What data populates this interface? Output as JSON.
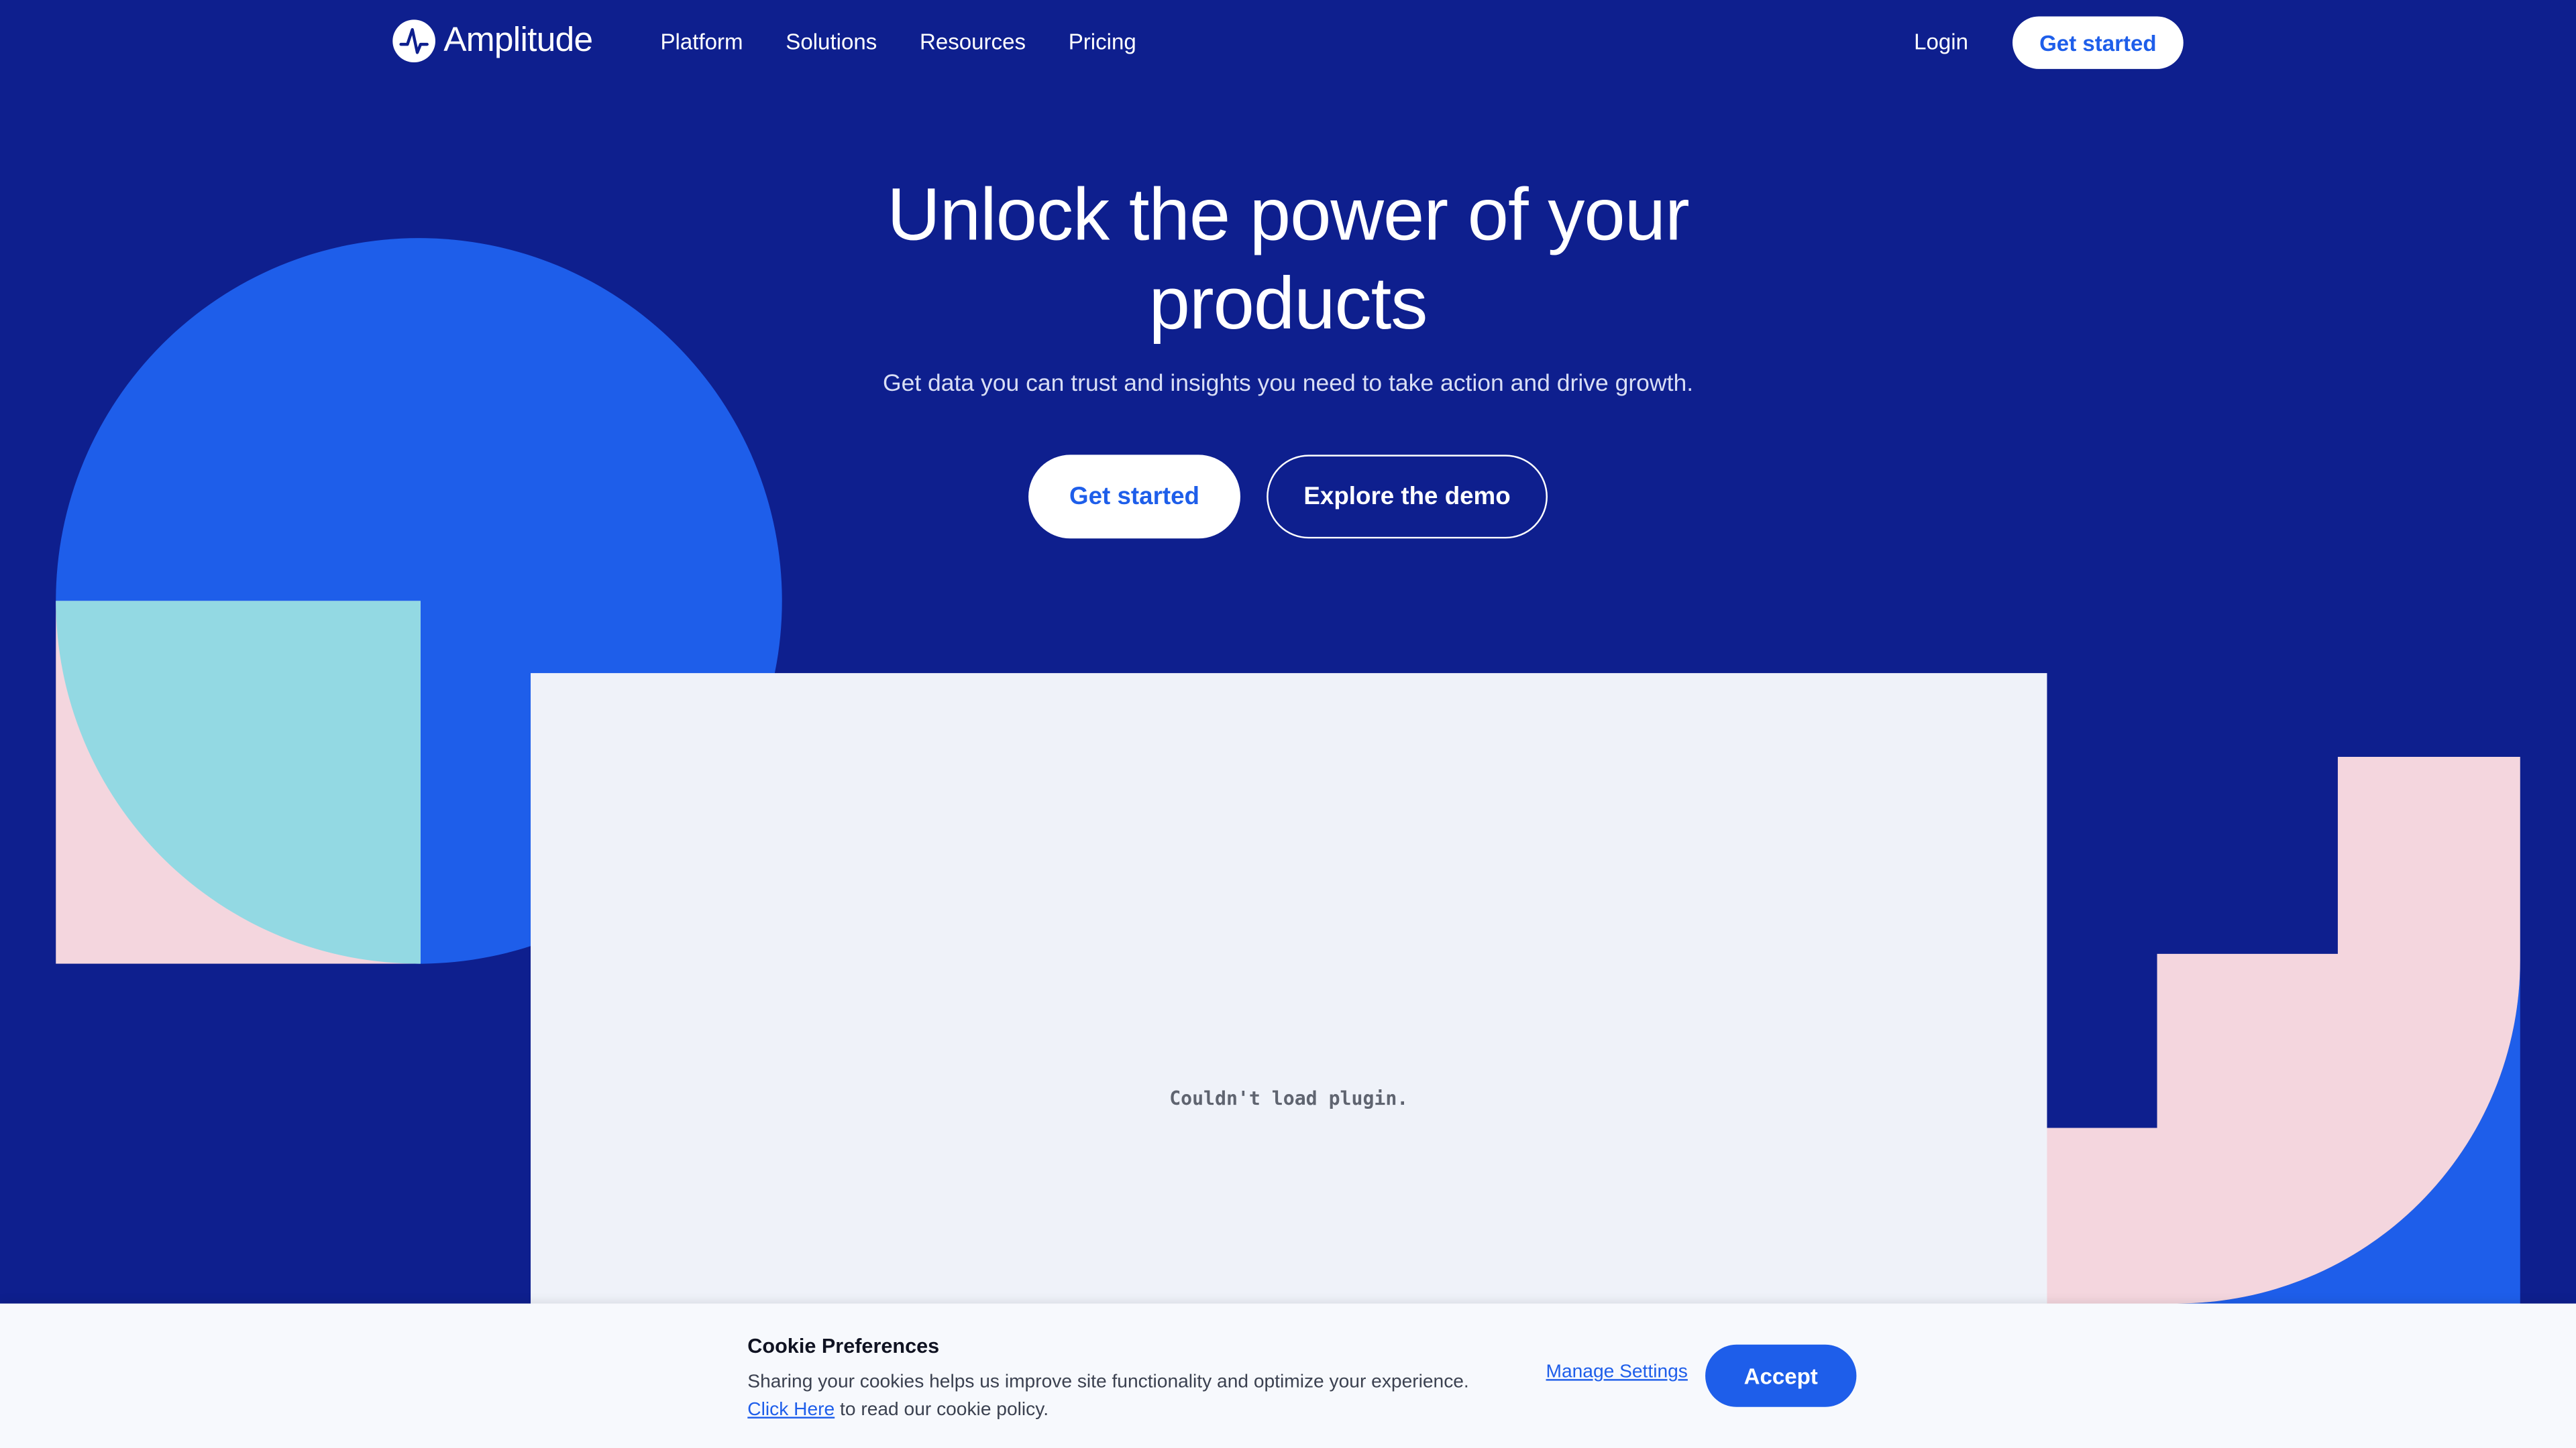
{
  "colors": {
    "background": "#0E1F8E",
    "accent_blue": "#1E5EEA",
    "light_cyan": "#93D9E3",
    "light_pink": "#F4D6DE",
    "plugin_bg": "#EFF2F9",
    "white": "#FFFFFF"
  },
  "nav": {
    "logo_icon": "amplitude-logo-icon",
    "logo_text": "Amplitude",
    "links": [
      "Platform",
      "Solutions",
      "Resources",
      "Pricing"
    ],
    "login": "Login",
    "cta": "Get started"
  },
  "hero": {
    "title": "Unlock the power of your products",
    "subtitle": "Get data you can trust and insights you need to take action and drive growth.",
    "primary_button": "Get started",
    "secondary_button": "Explore the demo"
  },
  "plugin": {
    "message": "Couldn't load plugin."
  },
  "cookie": {
    "title": "Cookie Preferences",
    "body": "Sharing your cookies helps us improve site functionality and optimize your experience.",
    "link_text": "Click Here",
    "link_suffix": " to read our cookie policy.",
    "manage": "Manage Settings",
    "accept": "Accept"
  }
}
